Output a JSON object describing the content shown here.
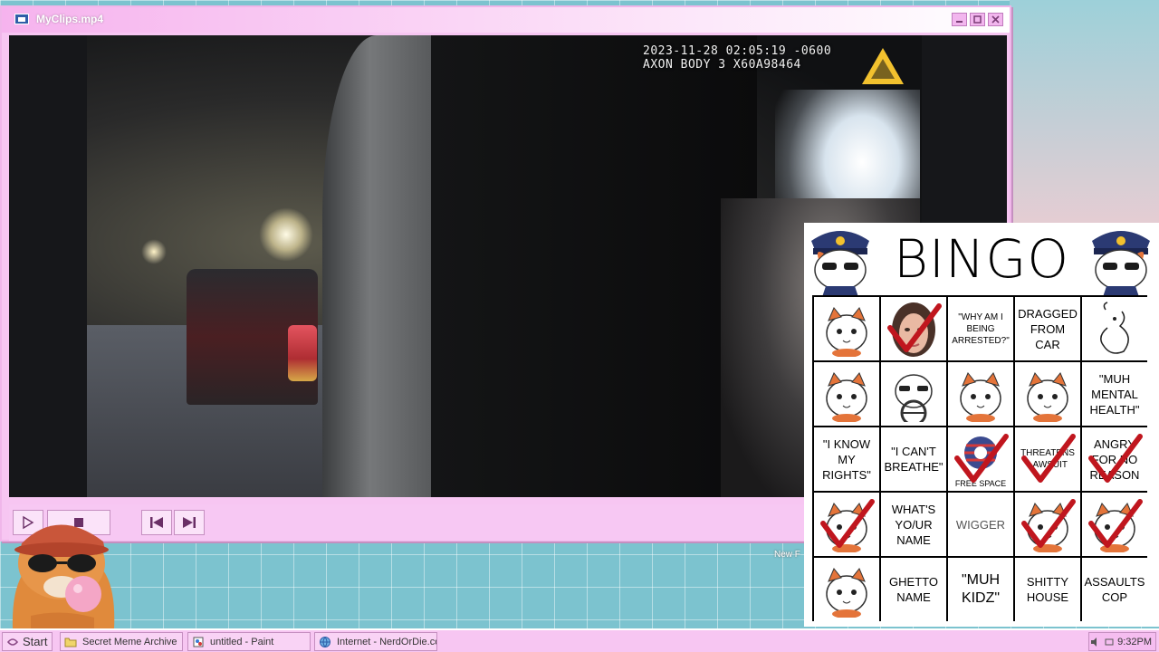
{
  "window": {
    "title": "MyClips.mp4",
    "title_icon": "video-file-icon",
    "buttons": [
      "minimize-icon",
      "maximize-icon",
      "close-icon"
    ]
  },
  "video": {
    "timestamp": "2023-11-28 02:05:19 -0600",
    "device": "AXON BODY 3 X60A98464"
  },
  "controls": {
    "icons": [
      "play-icon",
      "stop-icon",
      "previous-icon",
      "next-icon"
    ]
  },
  "desktop": {
    "partial_label": "New F"
  },
  "bingo": {
    "title": "BINGO",
    "cells": [
      {
        "text": "",
        "art": "cat-sticker",
        "checked": false
      },
      {
        "text": "",
        "art": "woman-face",
        "checked": true
      },
      {
        "text": "\"WHY AM I BEING ARRESTED?\"",
        "style": "small",
        "checked": false
      },
      {
        "text": "DRAGGED FROM CAR",
        "checked": false
      },
      {
        "text": "",
        "art": "cat-sketch",
        "checked": false
      },
      {
        "text": "",
        "art": "cat-sticker",
        "checked": false
      },
      {
        "text": "",
        "art": "cat-driving",
        "checked": false
      },
      {
        "text": "",
        "art": "cat-sticker",
        "checked": false
      },
      {
        "text": "",
        "art": "cat-sticker",
        "checked": false
      },
      {
        "text": "\"MUH MENTAL HEALTH\"",
        "checked": false
      },
      {
        "text": "\"I KNOW MY RIGHTS\"",
        "checked": false
      },
      {
        "text": "\"I CAN'T BREATHE\"",
        "checked": false
      },
      {
        "text": "FREE SPACE",
        "style": "free",
        "art": "free-space-art",
        "checked": true
      },
      {
        "text": "THREATENS LAWSUIT",
        "style": "small",
        "checked": true
      },
      {
        "text": "ANGRY FOR NO REASON",
        "checked": true
      },
      {
        "text": "",
        "art": "cat-sticker",
        "checked": true
      },
      {
        "text": "WHAT'S YO/UR NAME",
        "checked": false
      },
      {
        "text": "WIGGER",
        "style": "gray",
        "checked": false
      },
      {
        "text": "",
        "art": "cat-sticker",
        "checked": true
      },
      {
        "text": "",
        "art": "cat-sticker",
        "checked": true
      },
      {
        "text": "",
        "art": "cat-sticker",
        "checked": false
      },
      {
        "text": "GHETTO NAME",
        "checked": false
      },
      {
        "text": "\"MUH KIDZ\"",
        "style": "big",
        "checked": false
      },
      {
        "text": "SHITTY HOUSE",
        "checked": false
      },
      {
        "text": "ASSAULTS COP",
        "checked": false
      }
    ]
  },
  "taskbar": {
    "start": "Start",
    "tasks": [
      {
        "label": "Secret Meme Archive",
        "icon": "folder-icon"
      },
      {
        "label": "untitled - Paint",
        "icon": "paint-icon"
      },
      {
        "label": "Internet - NerdOrDie.com",
        "icon": "globe-icon"
      }
    ],
    "clock": "9:32PM"
  },
  "colors": {
    "window_pink": "#f7c6f2",
    "check_red": "#c0161e",
    "desktop_teal": "#7cc3cf"
  }
}
